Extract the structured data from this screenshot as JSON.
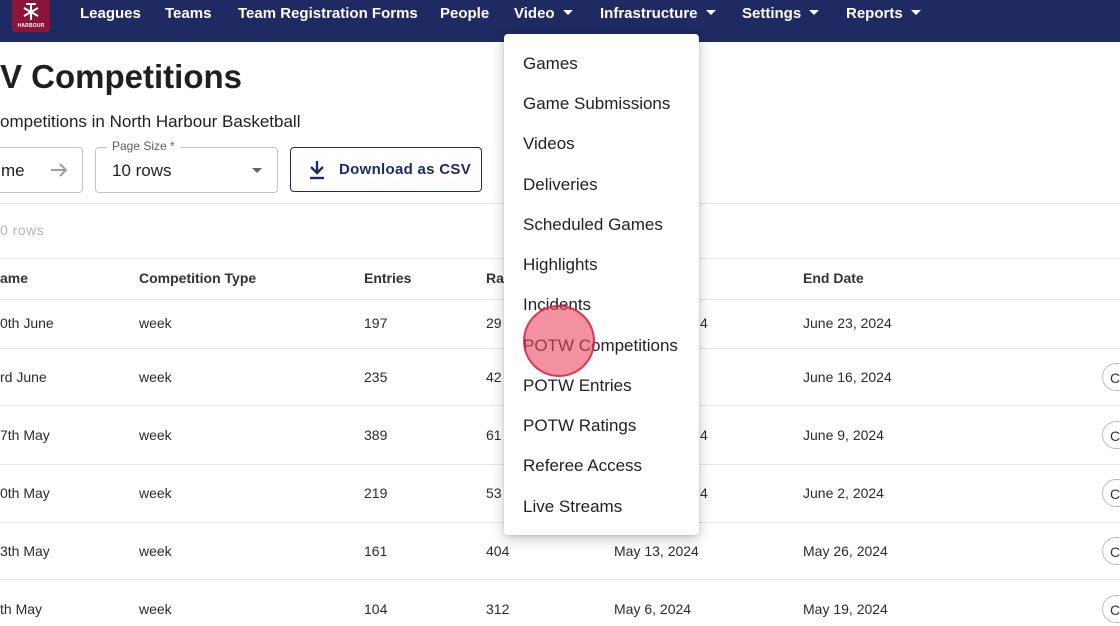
{
  "nav": {
    "logo_text": "HARBOUR",
    "items": [
      {
        "label": "Leagues"
      },
      {
        "label": "Teams"
      },
      {
        "label": "Team Registration Forms"
      },
      {
        "label": "People"
      },
      {
        "label": "Video"
      },
      {
        "label": "Infrastructure"
      },
      {
        "label": "Settings"
      },
      {
        "label": "Reports"
      }
    ]
  },
  "page": {
    "title": "V Competitions",
    "subtitle": "ompetitions in North Harbour Basketball"
  },
  "controls": {
    "search_value": "me",
    "page_size_label": "Page Size *",
    "page_size_value": "10 rows",
    "csv_button_label": "Download as CSV"
  },
  "row_count": "0 rows",
  "table": {
    "headers": [
      "ame",
      "Competition Type",
      "Entries",
      "Ra",
      "End Date"
    ],
    "rows": [
      {
        "name": "0th June",
        "type": "week",
        "entries": "197",
        "ra": "29",
        "start": "4",
        "end": "June 23, 2024",
        "action": ""
      },
      {
        "name": "rd June",
        "type": "week",
        "entries": "235",
        "ra": "42",
        "start": "",
        "end": "June 16, 2024",
        "action": "C"
      },
      {
        "name": "7th May",
        "type": "week",
        "entries": "389",
        "ra": "61",
        "start": "4",
        "end": "June 9, 2024",
        "action": "C"
      },
      {
        "name": "0th May",
        "type": "week",
        "entries": "219",
        "ra": "53",
        "start": "4",
        "end": "June 2, 2024",
        "action": "C"
      },
      {
        "name": "3th May",
        "type": "week",
        "entries": "161",
        "ra": "404",
        "start": "May 13, 2024",
        "end": "May 26, 2024",
        "action": "C"
      },
      {
        "name": "th May",
        "type": "week",
        "entries": "104",
        "ra": "312",
        "start": "May 6, 2024",
        "end": "May 19, 2024",
        "action": "C"
      }
    ]
  },
  "menu": {
    "items": [
      {
        "label": "Games"
      },
      {
        "label": "Game Submissions"
      },
      {
        "label": "Videos"
      },
      {
        "label": "Deliveries"
      },
      {
        "label": "Scheduled Games"
      },
      {
        "label": "Highlights"
      },
      {
        "label": "Incidents"
      },
      {
        "label": "POTW Competitions"
      },
      {
        "label": "POTW Entries"
      },
      {
        "label": "POTW Ratings"
      },
      {
        "label": "Referee Access"
      },
      {
        "label": "Live Streams"
      }
    ]
  },
  "colors": {
    "nav_background": "#1f2a63",
    "logo_background": "#8a1538",
    "click_marker": "#eb4664"
  }
}
